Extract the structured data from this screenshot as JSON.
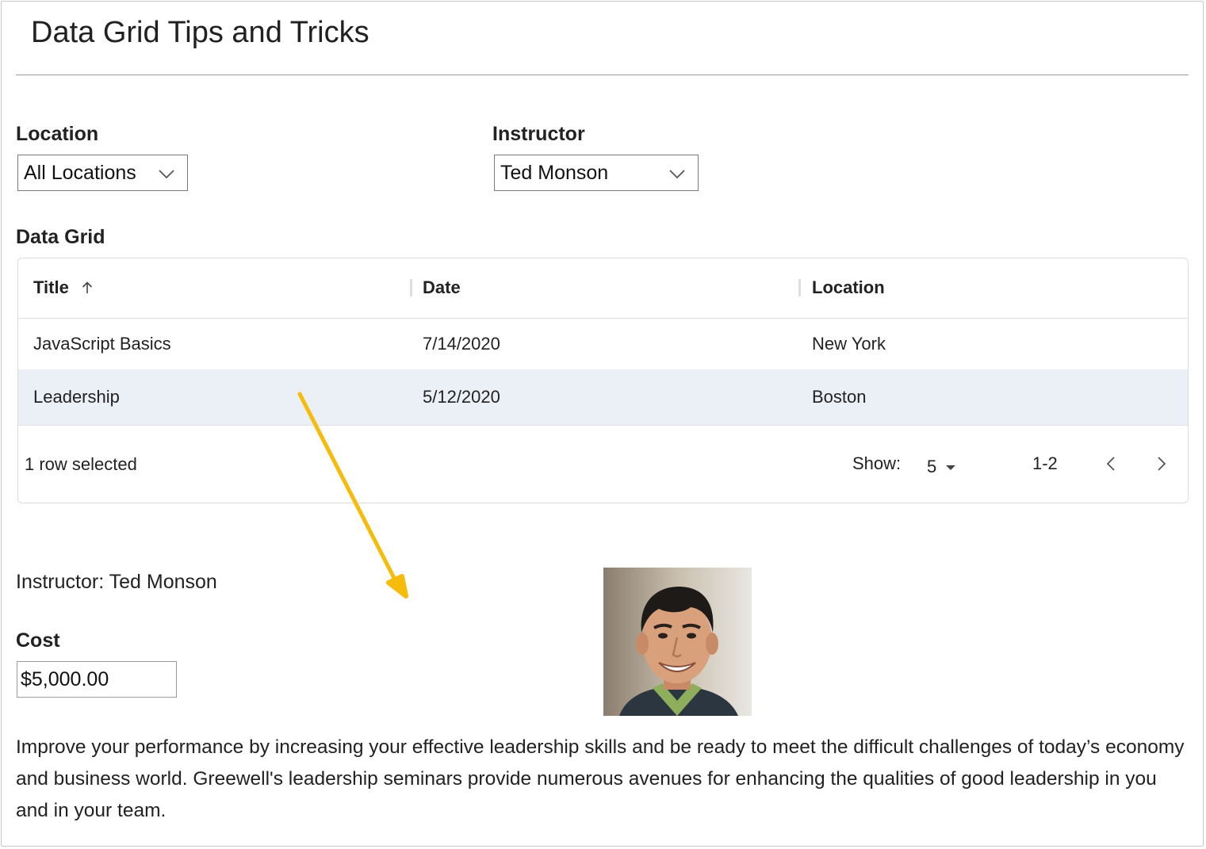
{
  "page": {
    "title": "Data Grid Tips and Tricks"
  },
  "filters": {
    "location_label": "Location",
    "location_value": "All Locations",
    "instructor_label": "Instructor",
    "instructor_value": "Ted Monson"
  },
  "grid": {
    "label": "Data Grid",
    "columns": [
      "Title",
      "Date",
      "Location"
    ],
    "sort": {
      "column": "Title",
      "direction": "ascending"
    },
    "rows": [
      {
        "title": "JavaScript Basics",
        "date": "7/14/2020",
        "location": "New York",
        "selected": false
      },
      {
        "title": "Leadership",
        "date": "5/12/2020",
        "location": "Boston",
        "selected": true
      }
    ],
    "footer": {
      "selection_text": "1 row selected",
      "show_label": "Show:",
      "page_size": "5",
      "range": "1-2"
    }
  },
  "details": {
    "instructor_text": "Instructor: Ted Monson",
    "cost_label": "Cost",
    "cost_value": "$5,000.00",
    "photo_icon": "instructor-photo",
    "description": "Improve your performance by increasing your effective leadership skills and be ready to meet the difficult challenges of today’s economy and business world. Greewell's leadership seminars provide numerous avenues for enhancing the qualities of good leadership in you and in your team."
  },
  "colors": {
    "selected_row": "#ebeff6",
    "annotation_arrow": "#f6bb0b",
    "border": "#dcdcdc"
  }
}
